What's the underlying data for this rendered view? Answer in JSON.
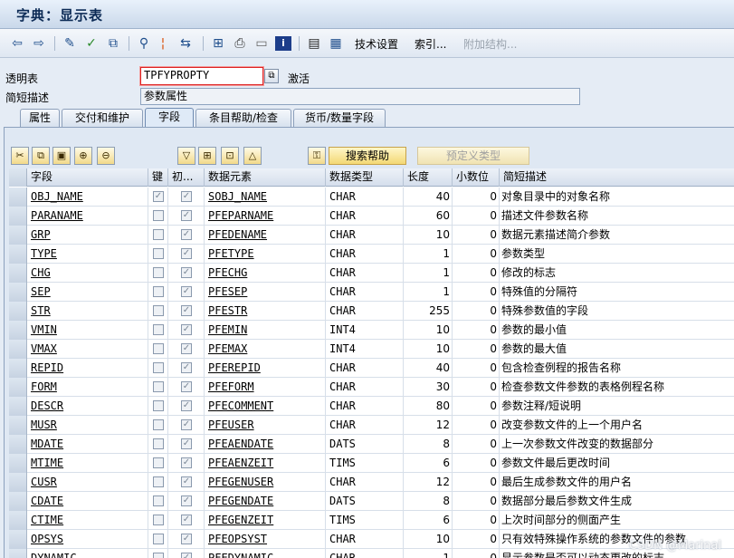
{
  "window": {
    "title": "字典：显示表"
  },
  "toolbar": {
    "icons": [
      "back-icon",
      "forward-icon",
      "other-object-icon",
      "display-change-icon",
      "activate-icon",
      "where-used-icon",
      "position-icon",
      "navigate-icon",
      "hierarchy-icon",
      "print-icon",
      "display-icon",
      "info-icon",
      "indexes-icon",
      "table-contents-icon"
    ],
    "tech_settings": "技术设置",
    "index": "索引...",
    "append_struct": "附加结构..."
  },
  "header": {
    "table_label": "透明表",
    "table_value": "TPFYPROPTY",
    "status": "激活",
    "desc_label": "简短描述",
    "desc_value": "参数属性"
  },
  "tabs": [
    "属性",
    "交付和维护",
    "字段",
    "条目帮助/检查",
    "货币/数量字段"
  ],
  "active_tab": "字段",
  "buttons": {
    "search_help": "搜索帮助",
    "predefined_type": "预定义类型"
  },
  "columns": [
    "字段",
    "键",
    "初...",
    "数据元素",
    "数据类型",
    "长度",
    "小数位",
    "简短描述"
  ],
  "rows": [
    {
      "field": "OBJ_NAME",
      "key": true,
      "init": true,
      "element": "SOBJ_NAME",
      "type": "CHAR",
      "len": "40",
      "dec": "0",
      "desc": "对象目录中的对象名称"
    },
    {
      "field": "PARANAME",
      "key": false,
      "init": true,
      "element": "PFEPARNAME",
      "type": "CHAR",
      "len": "60",
      "dec": "0",
      "desc": "描述文件参数名称"
    },
    {
      "field": "GRP",
      "key": false,
      "init": true,
      "element": "PFEDENAME",
      "type": "CHAR",
      "len": "10",
      "dec": "0",
      "desc": "数据元素描述简介参数"
    },
    {
      "field": "TYPE",
      "key": false,
      "init": true,
      "element": "PFETYPE",
      "type": "CHAR",
      "len": "1",
      "dec": "0",
      "desc": "参数类型"
    },
    {
      "field": "CHG",
      "key": false,
      "init": true,
      "element": "PFECHG",
      "type": "CHAR",
      "len": "1",
      "dec": "0",
      "desc": "修改的标志"
    },
    {
      "field": "SEP",
      "key": false,
      "init": true,
      "element": "PFESEP",
      "type": "CHAR",
      "len": "1",
      "dec": "0",
      "desc": "特殊值的分隔符"
    },
    {
      "field": "STR",
      "key": false,
      "init": true,
      "element": "PFESTR",
      "type": "CHAR",
      "len": "255",
      "dec": "0",
      "desc": "特殊参数值的字段"
    },
    {
      "field": "VMIN",
      "key": false,
      "init": true,
      "element": "PFEMIN",
      "type": "INT4",
      "len": "10",
      "dec": "0",
      "desc": "参数的最小值"
    },
    {
      "field": "VMAX",
      "key": false,
      "init": true,
      "element": "PFEMAX",
      "type": "INT4",
      "len": "10",
      "dec": "0",
      "desc": "参数的最大值"
    },
    {
      "field": "REPID",
      "key": false,
      "init": true,
      "element": "PFEREPID",
      "type": "CHAR",
      "len": "40",
      "dec": "0",
      "desc": "包含检查例程的报告名称"
    },
    {
      "field": "FORM",
      "key": false,
      "init": true,
      "element": "PFEFORM",
      "type": "CHAR",
      "len": "30",
      "dec": "0",
      "desc": "检查参数文件参数的表格例程名称"
    },
    {
      "field": "DESCR",
      "key": false,
      "init": true,
      "element": "PFECOMMENT",
      "type": "CHAR",
      "len": "80",
      "dec": "0",
      "desc": "参数注释/短说明"
    },
    {
      "field": "MUSR",
      "key": false,
      "init": true,
      "element": "PFEUSER",
      "type": "CHAR",
      "len": "12",
      "dec": "0",
      "desc": "改变参数文件的上一个用户名"
    },
    {
      "field": "MDATE",
      "key": false,
      "init": true,
      "element": "PFEAENDATE",
      "type": "DATS",
      "len": "8",
      "dec": "0",
      "desc": "上一次参数文件改变的数据部分"
    },
    {
      "field": "MTIME",
      "key": false,
      "init": true,
      "element": "PFEAENZEIT",
      "type": "TIMS",
      "len": "6",
      "dec": "0",
      "desc": "参数文件最后更改时间"
    },
    {
      "field": "CUSR",
      "key": false,
      "init": true,
      "element": "PFEGENUSER",
      "type": "CHAR",
      "len": "12",
      "dec": "0",
      "desc": "最后生成参数文件的用户名"
    },
    {
      "field": "CDATE",
      "key": false,
      "init": true,
      "element": "PFEGENDATE",
      "type": "DATS",
      "len": "8",
      "dec": "0",
      "desc": "数据部分最后参数文件生成"
    },
    {
      "field": "CTIME",
      "key": false,
      "init": true,
      "element": "PFEGENZEIT",
      "type": "TIMS",
      "len": "6",
      "dec": "0",
      "desc": "上次时间部分的侧面产生"
    },
    {
      "field": "OPSYS",
      "key": false,
      "init": true,
      "element": "PFEOPSYST",
      "type": "CHAR",
      "len": "10",
      "dec": "0",
      "desc": "只有效特殊操作系统的参数文件的参数"
    },
    {
      "field": "DYNAMIC",
      "key": false,
      "init": true,
      "element": "PFEDYNAMIC",
      "type": "CHAR",
      "len": "1",
      "dec": "0",
      "desc": "显示参数是否可以动态更改的标志"
    }
  ],
  "watermark": "CSDN @Marinal"
}
